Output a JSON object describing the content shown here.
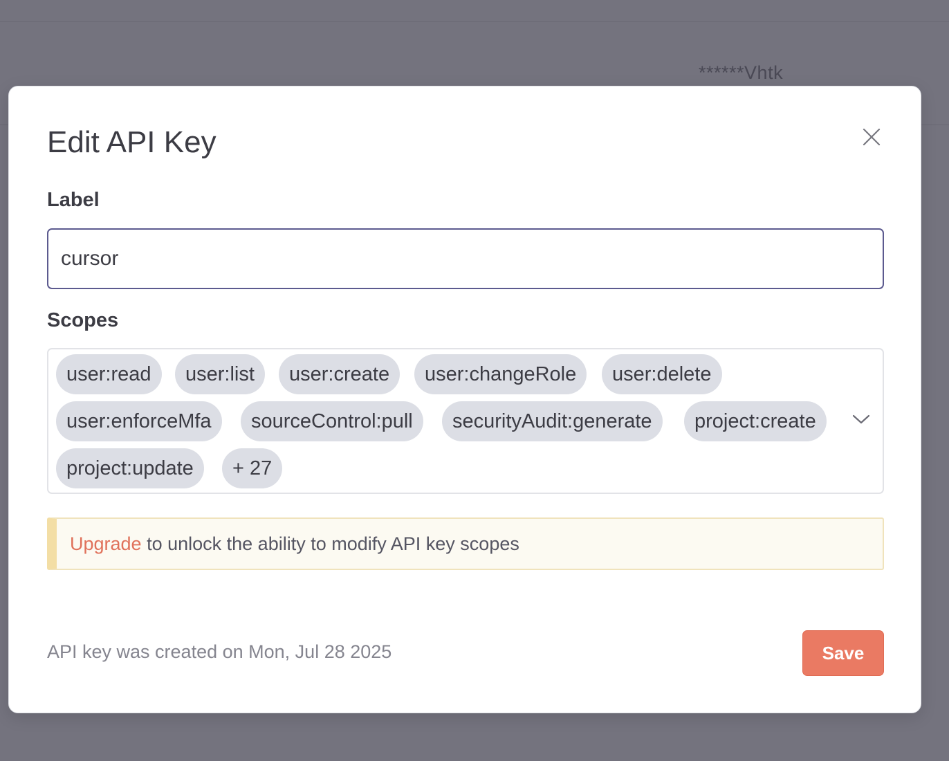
{
  "background": {
    "masked_key": "******Vhtk"
  },
  "modal": {
    "title": "Edit API Key",
    "close_icon": "close-icon",
    "label": {
      "heading": "Label",
      "value": "cursor"
    },
    "scopes": {
      "heading": "Scopes",
      "chips": [
        "user:read",
        "user:list",
        "user:create",
        "user:changeRole",
        "user:delete",
        "user:enforceMfa",
        "sourceControl:pull",
        "securityAudit:generate",
        "project:create",
        "project:update"
      ],
      "more": "+ 27",
      "dropdown_icon": "chevron-down-icon"
    },
    "notice": {
      "link": "Upgrade",
      "text": " to unlock the ability to modify API key scopes"
    },
    "footer": {
      "created": "API key was created on Mon, Jul 28 2025",
      "save_label": "Save"
    }
  },
  "colors": {
    "overlay": "#74737e",
    "accent": "#ea7a63",
    "link": "#e0715a",
    "input_border": "#5c5a8f",
    "chip": "#dcdee5",
    "notice_bg": "#fcfaf2",
    "notice_bar": "#f3dea5"
  }
}
